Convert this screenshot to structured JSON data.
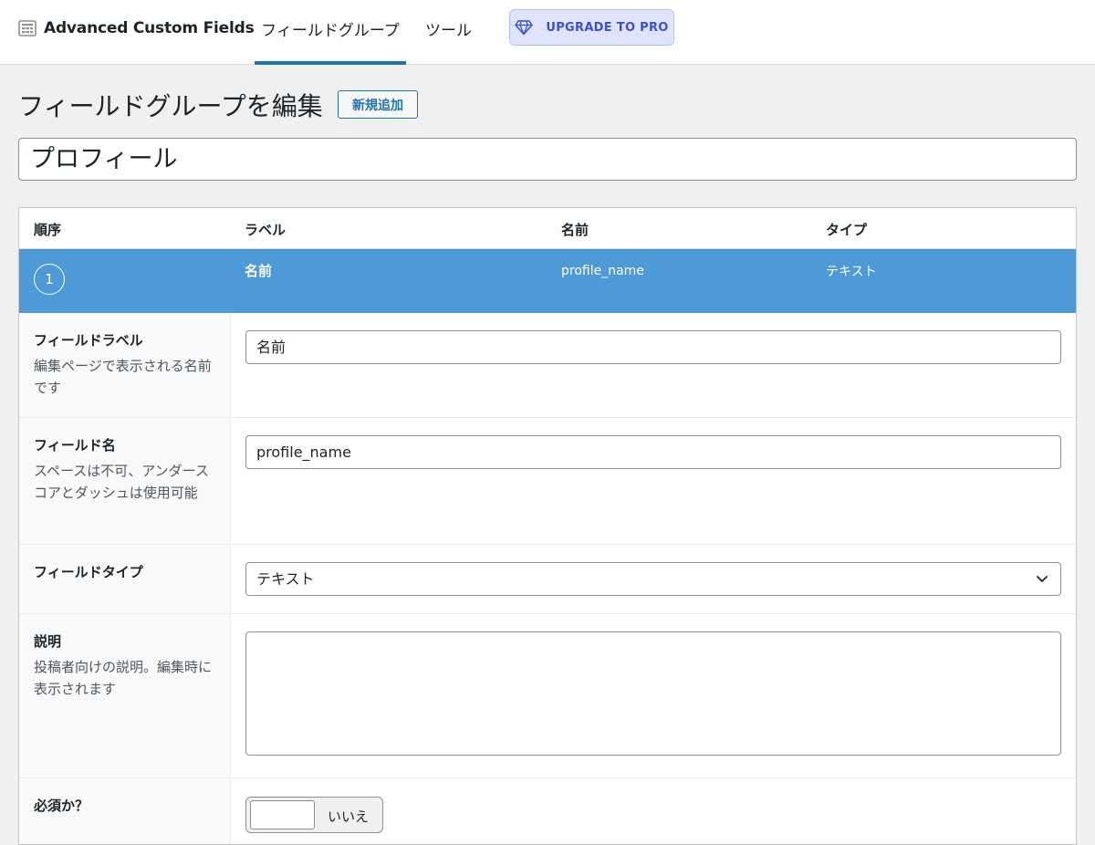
{
  "app": {
    "name": "Advanced Custom Fields"
  },
  "nav": {
    "tabs": [
      {
        "label": "フィールドグループ",
        "active": true
      },
      {
        "label": "ツール",
        "active": false
      }
    ],
    "upgrade": {
      "label": "UPGRADE TO PRO",
      "icon": "diamond-icon"
    }
  },
  "page": {
    "title": "フィールドグループを編集",
    "add_new": "新規追加",
    "group_title": "プロフィール"
  },
  "fields_table": {
    "columns": {
      "order": "順序",
      "label": "ラベル",
      "name": "名前",
      "type": "タイプ"
    },
    "row": {
      "order": "1",
      "label": "名前",
      "name": "profile_name",
      "type": "テキスト"
    },
    "row_color": "#4e9ad6"
  },
  "settings": {
    "field_label": {
      "title": "フィールドラベル",
      "desc": "編集ページで表示される名前です",
      "value": "名前"
    },
    "field_name": {
      "title": "フィールド名",
      "desc": "スペースは不可、アンダースコアとダッシュは使用可能",
      "value": "profile_name"
    },
    "field_type": {
      "title": "フィールドタイプ",
      "value": "テキスト"
    },
    "instructions": {
      "title": "説明",
      "desc": "投稿者向けの説明。編集時に表示されます",
      "value": ""
    },
    "required": {
      "title": "必須か？",
      "toggle_label": "いいえ",
      "checked": false
    }
  }
}
